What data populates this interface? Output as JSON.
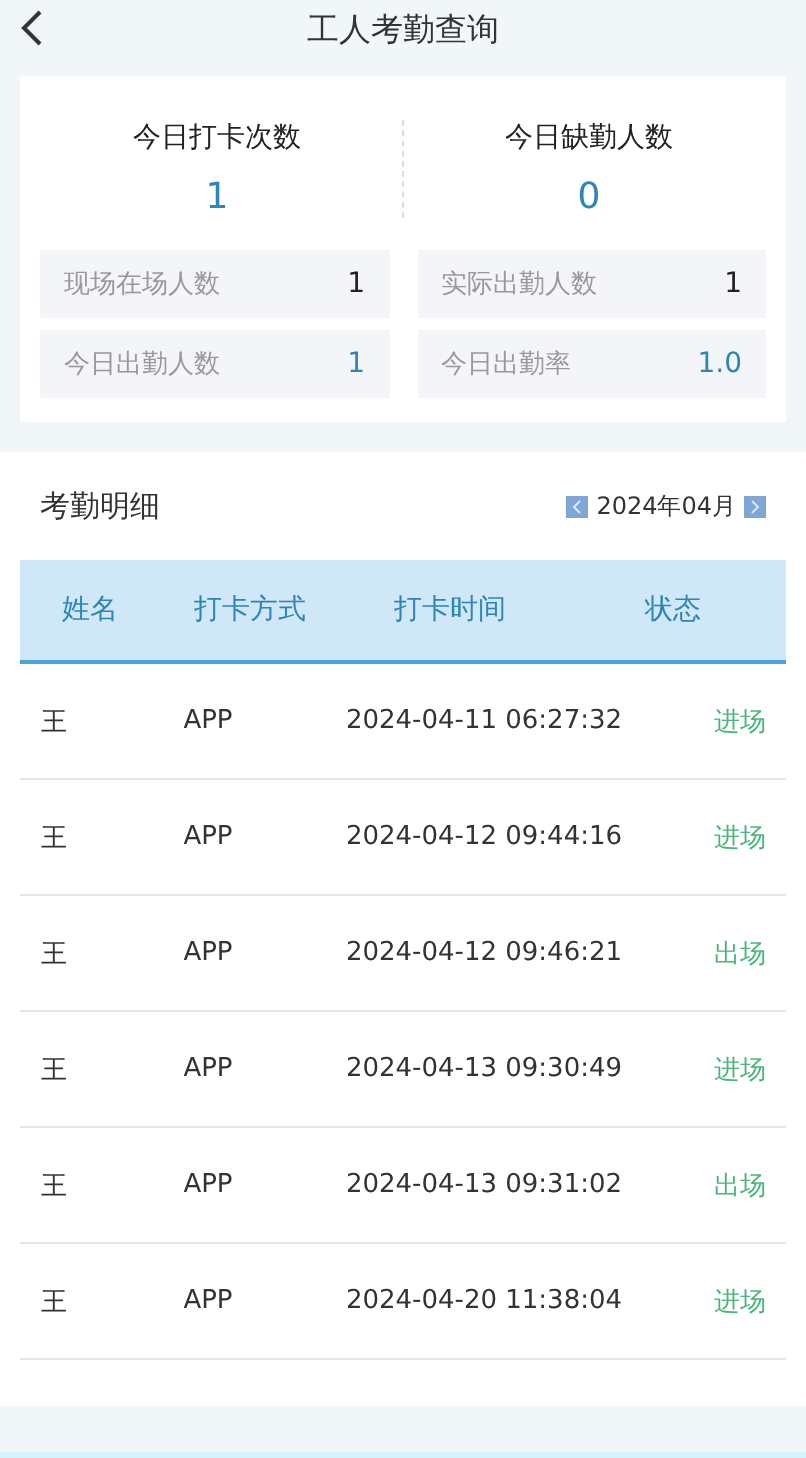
{
  "header": {
    "title": "工人考勤查询"
  },
  "summary": [
    {
      "label": "今日打卡次数",
      "value": "1"
    },
    {
      "label": "今日缺勤人数",
      "value": "0"
    }
  ],
  "stats": [
    {
      "label": "现场在场人数",
      "value": "1",
      "highlight": false
    },
    {
      "label": "实际出勤人数",
      "value": "1",
      "highlight": false
    },
    {
      "label": "今日出勤人数",
      "value": "1",
      "highlight": true
    },
    {
      "label": "今日出勤率",
      "value": "1.0",
      "highlight": true
    }
  ],
  "detail": {
    "title": "考勤明细",
    "month": "2024年04月"
  },
  "table": {
    "columns": [
      "姓名",
      "打卡方式",
      "打卡时间",
      "状态"
    ],
    "rows": [
      {
        "name": "王",
        "method": "APP",
        "time": "2024-04-11 06:27:32",
        "status": "进场"
      },
      {
        "name": "王",
        "method": "APP",
        "time": "2024-04-12 09:44:16",
        "status": "进场"
      },
      {
        "name": "王",
        "method": "APP",
        "time": "2024-04-12 09:46:21",
        "status": "出场"
      },
      {
        "name": "王",
        "method": "APP",
        "time": "2024-04-13 09:30:49",
        "status": "进场"
      },
      {
        "name": "王",
        "method": "APP",
        "time": "2024-04-13 09:31:02",
        "status": "出场"
      },
      {
        "name": "王",
        "method": "APP",
        "time": "2024-04-20 11:38:04",
        "status": "进场"
      }
    ]
  }
}
